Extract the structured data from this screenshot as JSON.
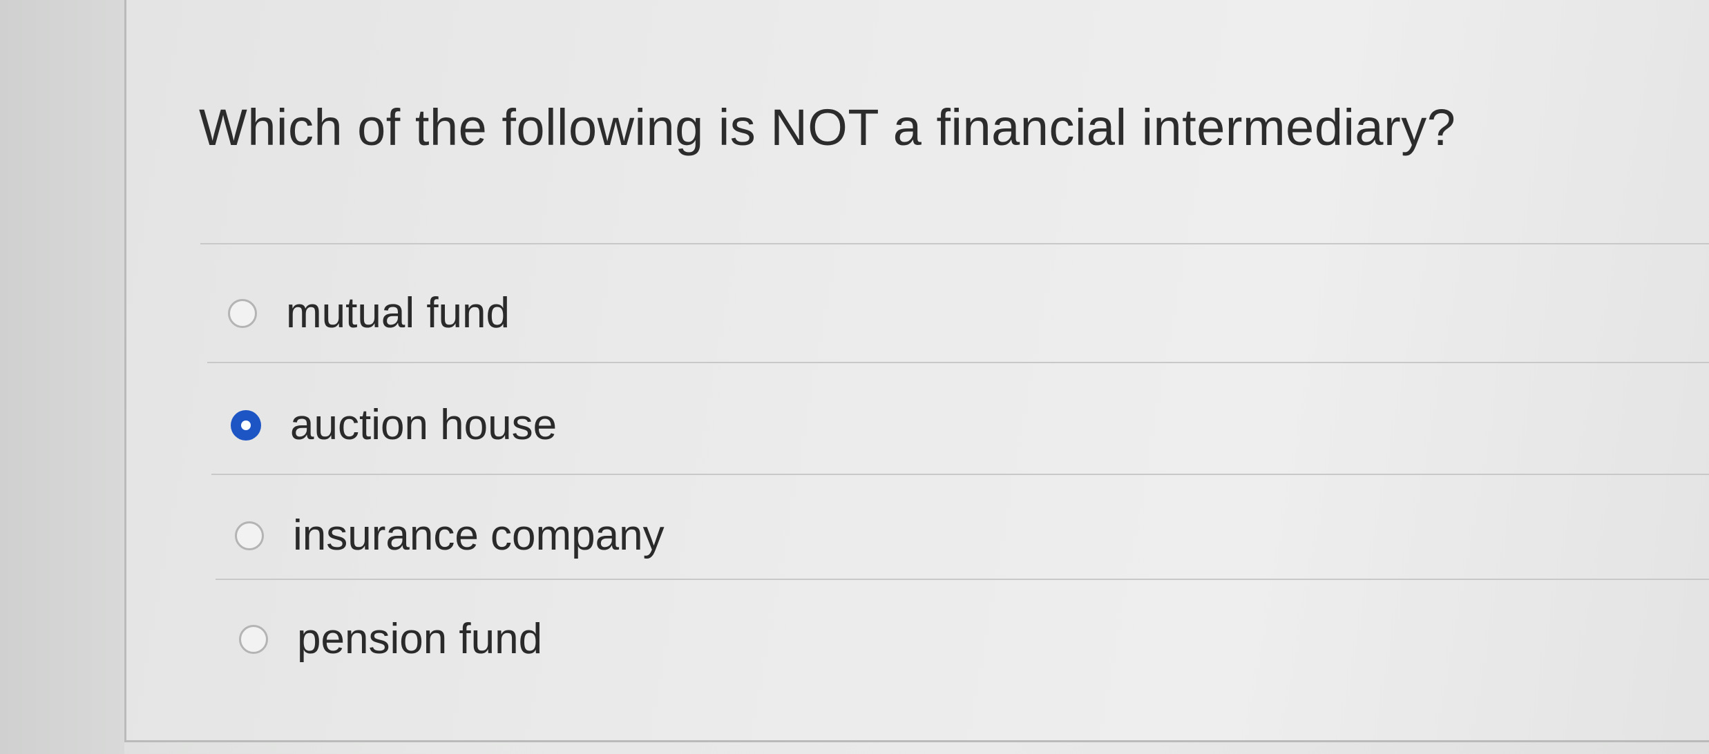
{
  "question": {
    "text": "Which of the following is NOT a financial intermediary?"
  },
  "options": [
    {
      "label": "mutual fund",
      "selected": false
    },
    {
      "label": "auction house",
      "selected": true
    },
    {
      "label": "insurance company",
      "selected": false
    },
    {
      "label": "pension fund",
      "selected": false
    }
  ],
  "colors": {
    "selected_radio": "#1d55c4",
    "unselected_radio_border": "#b3b4b3",
    "text": "#2a2a2a"
  }
}
